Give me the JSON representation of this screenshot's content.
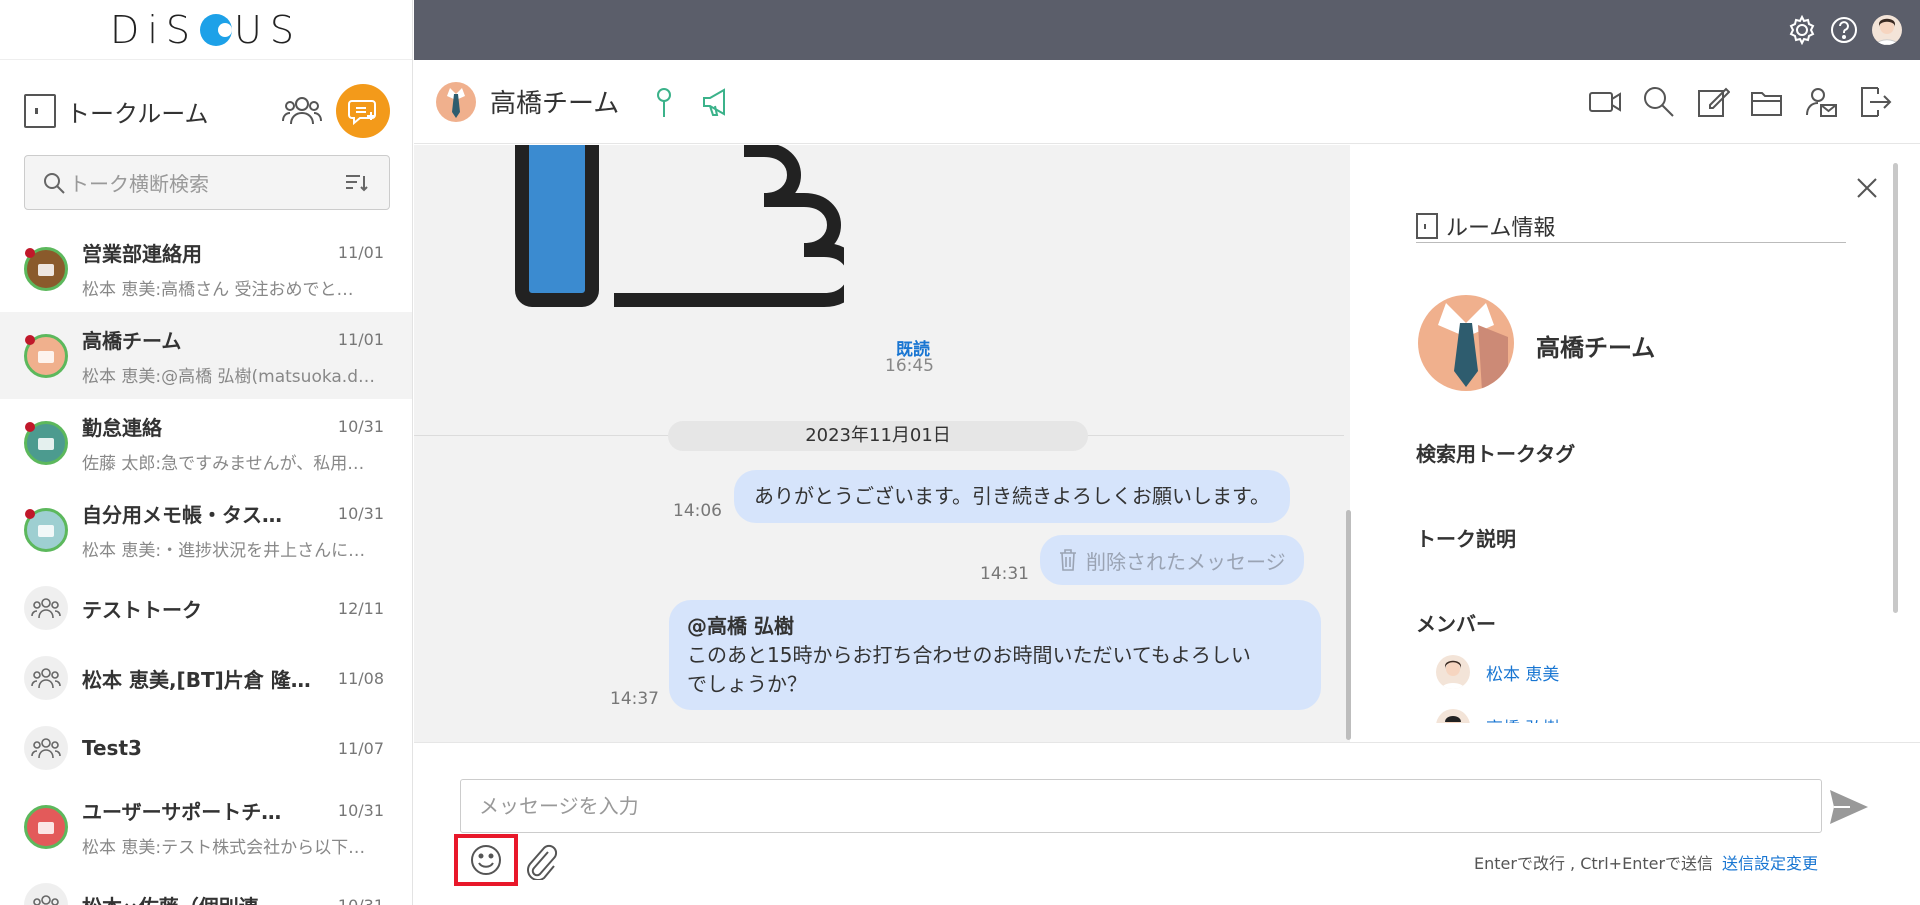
{
  "app": {
    "logo_text": "DiSCUS"
  },
  "sidebar": {
    "title": "トークルーム",
    "search_placeholder": "トーク横断検索",
    "talks": [
      {
        "name": "営業部連絡用",
        "date": "11/01",
        "preview": "松本 恵美:高橋さん 受注おめでと…",
        "unread": true,
        "avatar": "briefcase-avatar",
        "color": "#8a5a2b"
      },
      {
        "name": "高橋チーム",
        "date": "11/01",
        "preview": "松本 恵美:@高橋 弘樹(matsuoka.d…",
        "unread": true,
        "avatar": "tie-avatar",
        "color": "#f0b08d",
        "active": true
      },
      {
        "name": "勤怠連絡",
        "date": "10/31",
        "preview": "佐藤 太郎:急ですみませんが、私用…",
        "unread": true,
        "avatar": "people-avatar",
        "color": "#4c9b8f"
      },
      {
        "name": "自分用メモ帳・タス…",
        "date": "10/31",
        "preview": "松本 恵美:・進捗状況を井上さんに…",
        "unread": true,
        "avatar": "notepad-avatar",
        "color": "#9ecfd1"
      },
      {
        "name": "テストトーク",
        "date": "12/11",
        "preview": "",
        "unread": false,
        "avatar": "group-avatar",
        "color": "#eeeeee"
      },
      {
        "name": "松本 恵美,[BT]片倉 隆…",
        "date": "11/08",
        "preview": "",
        "unread": false,
        "avatar": "group-avatar",
        "color": "#eeeeee"
      },
      {
        "name": "Test3",
        "date": "11/07",
        "preview": "",
        "unread": false,
        "avatar": "group-avatar",
        "color": "#eeeeee"
      },
      {
        "name": "ユーザーサポートチ…",
        "date": "10/31",
        "preview": "松本 恵美:テスト株式会社から以下…",
        "unread": false,
        "avatar": "thumbs-up-avatar",
        "color": "#e35a5a"
      },
      {
        "name": "松本⇔佐藤（個別連…",
        "date": "10/31",
        "preview": "",
        "unread": false,
        "avatar": "group-avatar",
        "color": "#eeeeee"
      }
    ]
  },
  "chat": {
    "title": "高橋チーム",
    "read_label": "既読",
    "read_time": "16:45",
    "date_separator": "2023年11月01日",
    "messages": [
      {
        "text": "ありがとうございます。引き続きよろしくお願いします。",
        "time": "14:06"
      },
      {
        "text": "削除されたメッセージ",
        "time": "14:31",
        "deleted": true
      },
      {
        "mention": "@高橋 弘樹",
        "text_line1": "このあと15時からお打ち合わせのお時間いただいてもよろしい",
        "text_line2": "でしょうか？",
        "time": "14:37"
      }
    ]
  },
  "info": {
    "title": "ルーム情報",
    "room_name": "高橋チーム",
    "tag_label": "検索用トークタグ",
    "desc_label": "トーク説明",
    "members_label": "メンバー",
    "members": [
      "松本 恵美",
      "高橋 弘樹"
    ]
  },
  "composer": {
    "placeholder": "メッセージを入力",
    "hint": "Enterで改行 , Ctrl+Enterで送信",
    "settings_link": "送信設定変更"
  }
}
